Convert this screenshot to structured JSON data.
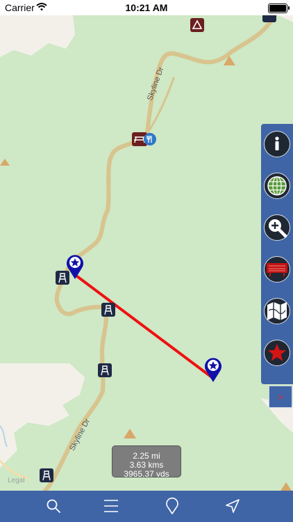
{
  "status_bar": {
    "carrier": "Carrier",
    "time": "10:21 AM"
  },
  "map": {
    "road_label_upper": "Skyline Dr",
    "road_label_lower": "Skyline Dr",
    "legal_label": "Legal",
    "colors": {
      "land": "#cfe8c6",
      "developed_area": "#f3f0ea",
      "road": "#f5deaa",
      "route_line": "#ee1111",
      "pin": "#1111aa"
    }
  },
  "measurement": {
    "miles": "2.25 mi",
    "kilometers": "3.63 kms",
    "yards": "3965.37 yds"
  },
  "side_toolbar": {
    "buttons": [
      "info-icon",
      "globe-icon",
      "zoom-in-icon",
      "park-sign-icon",
      "map-icon",
      "star-icon"
    ],
    "expand_label": ">"
  },
  "bottom_tabs": [
    "search-icon",
    "menu-icon",
    "pin-icon",
    "location-arrow-icon"
  ]
}
